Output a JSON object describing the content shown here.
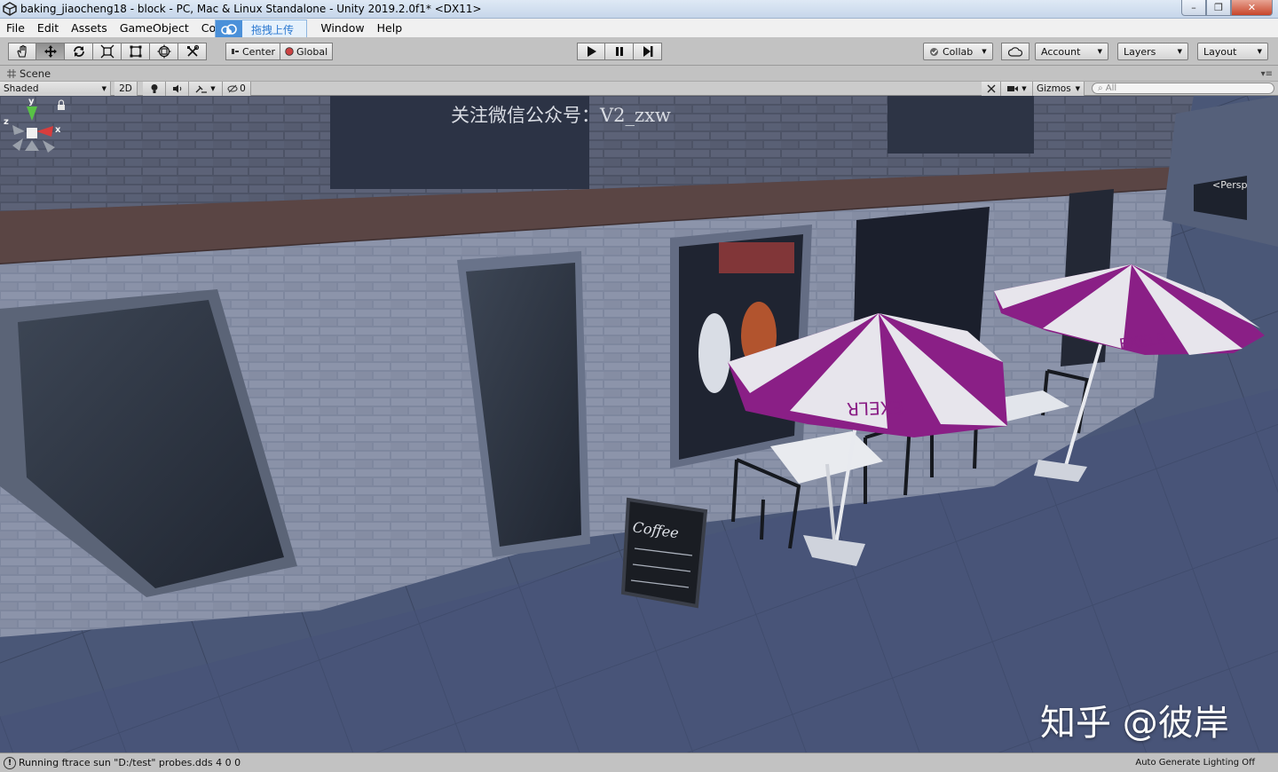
{
  "window": {
    "title": "baking_jiaocheng18 - block - PC, Mac & Linux Standalone - Unity 2019.2.0f1* <DX11>",
    "buttons": {
      "minimize": "–",
      "maximize": "❐",
      "close": "✕"
    }
  },
  "menu": {
    "items": [
      "File",
      "Edit",
      "Assets",
      "GameObject",
      "Com",
      "Window",
      "Help"
    ],
    "upload_overlay_label": "拖拽上传"
  },
  "toolbar": {
    "tools": [
      "hand-tool",
      "move-tool",
      "rotate-tool",
      "scale-tool",
      "rect-tool",
      "transform-tool",
      "custom-tool"
    ],
    "pivot_label": "Center",
    "space_label": "Global",
    "collab_label": "Collab",
    "account_label": "Account",
    "layers_label": "Layers",
    "layout_label": "Layout"
  },
  "scene_tab": {
    "label": "Scene"
  },
  "scene_toolbar": {
    "draw_mode": "Shaded",
    "mode_2d": "2D",
    "hidden_count": "0",
    "gizmos_label": "Gizmos",
    "search_placeholder": "All"
  },
  "viewport": {
    "watermark_top": "关注微信公众号：V2_zxw",
    "watermark_bottom": "知乎 @彼岸",
    "gizmo_labels": {
      "y": "y",
      "x": "x",
      "z": "z"
    },
    "projection_label": "<Persp",
    "umbrella_brand": "EXELR",
    "sign_text": "Coffee"
  },
  "status": {
    "message": "Running ftrace sun \"D:/test\" probes.dds 4 0 0",
    "lighting": "Auto Generate Lighting Off"
  },
  "colors": {
    "umbrella_purple": "#8a1f86",
    "sky_blue_dark": "#3f4c6d",
    "editor_gray": "#c2c2c2"
  }
}
